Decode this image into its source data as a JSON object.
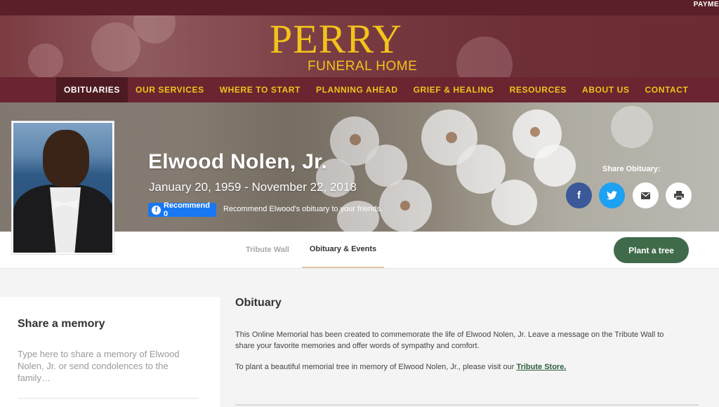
{
  "topbar": {
    "payments_label": "PAYME"
  },
  "logo": {
    "brand": "PERRY",
    "sub": "FUNERAL HOME"
  },
  "nav": {
    "items": [
      {
        "label": "OBITUARIES",
        "active": true
      },
      {
        "label": "OUR SERVICES"
      },
      {
        "label": "WHERE TO START"
      },
      {
        "label": "PLANNING AHEAD"
      },
      {
        "label": "GRIEF & HEALING"
      },
      {
        "label": "RESOURCES"
      },
      {
        "label": "ABOUT US"
      },
      {
        "label": "CONTACT"
      }
    ]
  },
  "profile": {
    "name": "Elwood Nolen, Jr.",
    "dates": "January 20, 1959 - November 22, 2018",
    "recommend_button": "Recommend 0",
    "recommend_text": "Recommend Elwood's obituary to your friends."
  },
  "share": {
    "label": "Share Obituary:",
    "icons": [
      "facebook-icon",
      "twitter-icon",
      "email-icon",
      "print-icon"
    ]
  },
  "tabs": [
    {
      "label": "Tribute Wall"
    },
    {
      "label": "Obituary & Events",
      "active": true
    }
  ],
  "plant_button": "Plant a tree",
  "memory": {
    "title": "Share a memory",
    "placeholder": "Type here to share a memory of Elwood Nolen, Jr. or send condolences to the family…"
  },
  "obituary": {
    "title": "Obituary",
    "paragraph1": "This Online Memorial has been created to commemorate the life of Elwood Nolen, Jr. Leave a message on the Tribute Wall to share your favorite memories and offer words of sympathy and comfort.",
    "paragraph2_prefix": "To plant a beautiful memorial tree in memory of Elwood Nolen, Jr., please visit our ",
    "paragraph2_link": "Tribute Store."
  },
  "colors": {
    "brand_maroon": "#6a2530",
    "logo_gold": "#f2c31b",
    "plant_green": "#3f6b4b",
    "facebook_blue": "#1877f2",
    "twitter_blue": "#1da1f2"
  }
}
